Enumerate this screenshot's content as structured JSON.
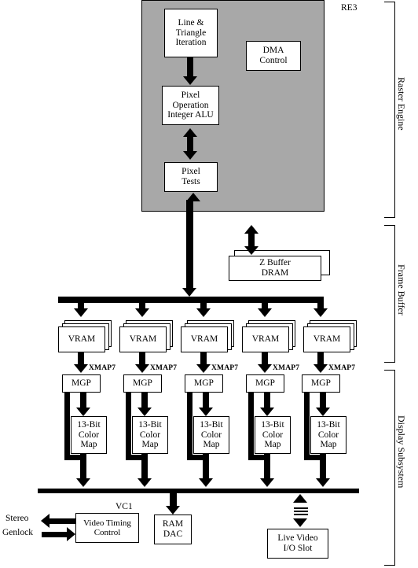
{
  "diagram": {
    "title_label": "RE3",
    "vc1_label": "VC1",
    "sections": [
      {
        "name": "Raster Engine"
      },
      {
        "name": "Frame Buffer"
      },
      {
        "name": "Display Subsystem"
      }
    ],
    "raster_engine": {
      "chip_label": "RE3",
      "blocks": [
        {
          "id": "line-triangle-iteration",
          "text": "Line &\nTriangle\nIteration"
        },
        {
          "id": "dma-control",
          "text": "DMA\nControl"
        },
        {
          "id": "pixel-operation-integer-alu",
          "text": "Pixel\nOperation\nInteger ALU"
        },
        {
          "id": "pixel-tests",
          "text": "Pixel\nTests"
        }
      ]
    },
    "frame_buffer": {
      "z_buffer": {
        "text": "Z Buffer\nDRAM"
      },
      "vram_label": "VRAM",
      "vram_count": 5
    },
    "display_subsystem": {
      "mgp_label": "MGP",
      "xmap_label": "XMAP7",
      "color_map_label": "13-Bit\nColor\nMap",
      "column_count": 5,
      "video_timing": {
        "label": "Video Timing\nControl",
        "chip": "VC1"
      },
      "ram_dac": {
        "label": "RAM\nDAC"
      },
      "live_video": {
        "label": "Live Video\nI/O Slot"
      },
      "stereo_label": "Stereo",
      "genlock_label": "Genlock"
    },
    "colors": {
      "panel_fill": "#a8a8a8",
      "line": "#000000",
      "box_fill": "#ffffff"
    }
  }
}
